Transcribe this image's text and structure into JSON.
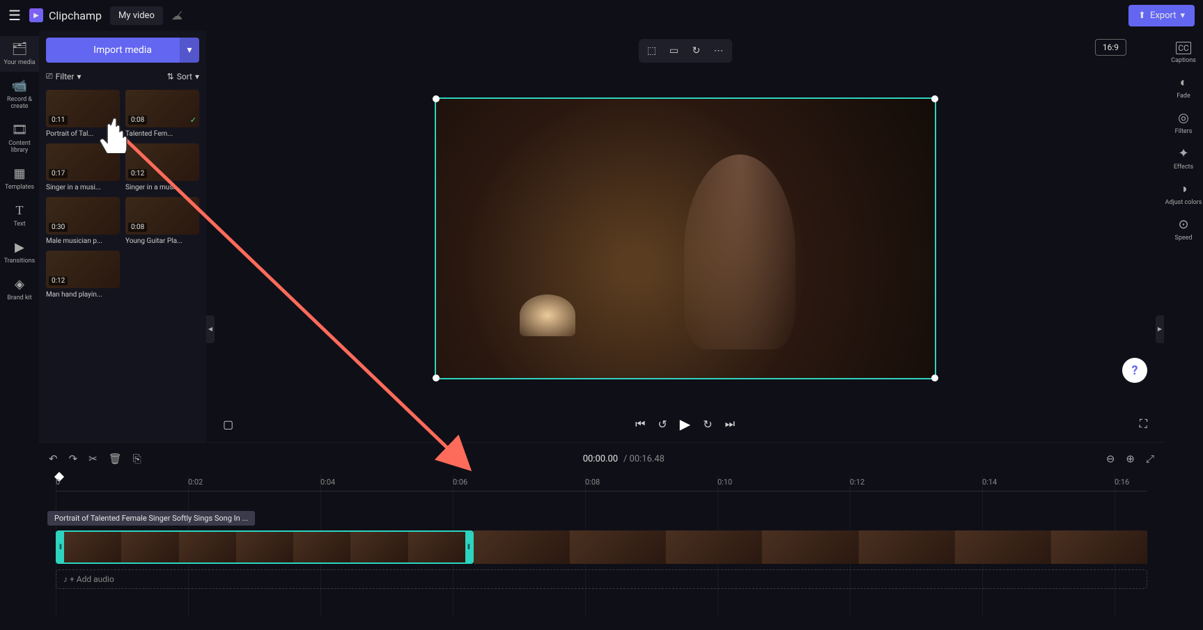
{
  "header": {
    "app_name": "Clipchamp",
    "video_title": "My video",
    "export_label": "Export"
  },
  "left_sidebar": {
    "items": [
      {
        "label": "Your media",
        "icon": "🗂"
      },
      {
        "label": "Record & create",
        "icon": "📹"
      },
      {
        "label": "Content library",
        "icon": "🎞"
      },
      {
        "label": "Templates",
        "icon": "▦"
      },
      {
        "label": "Text",
        "icon": "T"
      },
      {
        "label": "Transitions",
        "icon": "▶"
      },
      {
        "label": "Brand kit",
        "icon": "◈"
      }
    ]
  },
  "right_sidebar": {
    "items": [
      {
        "label": "Captions",
        "icon": "CC"
      },
      {
        "label": "Fade",
        "icon": "◐"
      },
      {
        "label": "Filters",
        "icon": "◎"
      },
      {
        "label": "Effects",
        "icon": "✦"
      },
      {
        "label": "Adjust colors",
        "icon": "◑"
      },
      {
        "label": "Speed",
        "icon": "⊙"
      }
    ]
  },
  "media_panel": {
    "import_label": "Import media",
    "filter_label": "Filter",
    "sort_label": "Sort",
    "items": [
      {
        "duration": "0:11",
        "name": "Portrait of Tal...",
        "checked": false
      },
      {
        "duration": "0:08",
        "name": "Talented Fem...",
        "checked": true
      },
      {
        "duration": "0:17",
        "name": "Singer in a musi...",
        "checked": false
      },
      {
        "duration": "0:12",
        "name": "Singer in a musi...",
        "checked": false
      },
      {
        "duration": "0:30",
        "name": "Male musician p...",
        "checked": false
      },
      {
        "duration": "0:08",
        "name": "Young Guitar Pla...",
        "checked": false
      },
      {
        "duration": "0:12",
        "name": "Man hand playin...",
        "checked": false
      }
    ]
  },
  "canvas": {
    "aspect_label": "16:9"
  },
  "timeline": {
    "current_time": "00:00.00",
    "total_time": "00:16.48",
    "ruler_ticks": [
      "0",
      "0:02",
      "0:04",
      "0:06",
      "0:08",
      "0:10",
      "0:12",
      "0:14",
      "0:16"
    ],
    "drop_tooltip": "Portrait of Talented Female Singer Softly Sings Song In ...",
    "add_audio_label": "+ Add audio"
  }
}
